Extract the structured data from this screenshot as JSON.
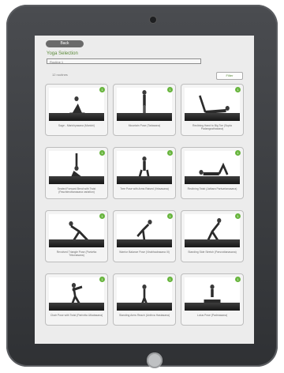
{
  "header": {
    "back_label": "Back",
    "title": "Yoga Selection",
    "field_value": "Routine 1",
    "list_header": "12 routines",
    "filter_label": "Filter"
  },
  "cards": [
    {
      "caption": "Sage - Marichyasana (Marichi)",
      "badge": "1"
    },
    {
      "caption": "Mountain Pose (Tadasana)",
      "badge": "1"
    },
    {
      "caption": "Reclining Hand to Big Toe (Supta Padangusthasana)",
      "badge": "1"
    },
    {
      "caption": "Seated Forward Bend with Twist (Paschimottanasana variation)",
      "badge": "1"
    },
    {
      "caption": "Tree Pose with Arms Raised (Vrksasana)",
      "badge": "1"
    },
    {
      "caption": "Reclining Twist (Jathara Parivartanasana)",
      "badge": "1"
    },
    {
      "caption": "Revolved Triangle Pose (Parivrtta Trikonasana)",
      "badge": "1"
    },
    {
      "caption": "Warrior Balance Pose (Virabhadrasana III)",
      "badge": "1"
    },
    {
      "caption": "Standing Side Stretch (Parsvottanasana)",
      "badge": "1"
    },
    {
      "caption": "Chair Pose with Twist (Parivrtta Utkatasana)",
      "badge": "1"
    },
    {
      "caption": "Standing Arms Reach (Urdhva Hastasana)",
      "badge": "1"
    },
    {
      "caption": "Lotus Pose (Padmasana)",
      "badge": "1"
    }
  ],
  "colors": {
    "accent": "#5b8a3a",
    "badge": "#68b53e",
    "bezel": "#3a3c40"
  }
}
